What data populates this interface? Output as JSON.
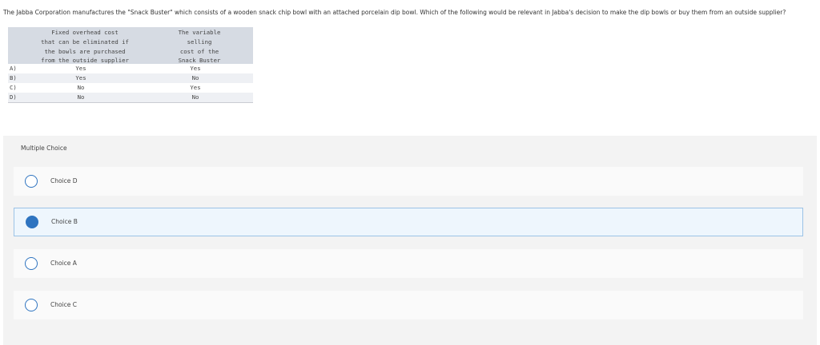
{
  "question": "The Jabba Corporation manufactures the \"Snack Buster\" which consists of a wooden snack chip bowl with an attached porcelain dip bowl. Which of the following would be relevant in Jabba's decision to make the dip bowls or buy them from an outside supplier?",
  "table": {
    "col1_header": [
      "Fixed overhead cost",
      "that can be eliminated if",
      "the bowls are purchased",
      "from the outside supplier"
    ],
    "col2_header": [
      "The variable",
      "selling",
      "cost of the",
      "Snack Buster"
    ],
    "rows": [
      {
        "label": "A)",
        "c1": "Yes",
        "c2": "Yes"
      },
      {
        "label": "B)",
        "c1": "Yes",
        "c2": "No"
      },
      {
        "label": "C)",
        "c1": "No",
        "c2": "Yes"
      },
      {
        "label": "D)",
        "c1": "No",
        "c2": "No"
      }
    ]
  },
  "multiple_choice_label": "Multiple Choice",
  "choices": [
    {
      "label": "Choice D",
      "selected": false
    },
    {
      "label": "Choice B",
      "selected": true
    },
    {
      "label": "Choice A",
      "selected": false
    },
    {
      "label": "Choice C",
      "selected": false
    }
  ],
  "colors": {
    "accent": "#2f74c0",
    "selected_bg": "#eef6fd",
    "header_bg": "#d6dbe3"
  }
}
